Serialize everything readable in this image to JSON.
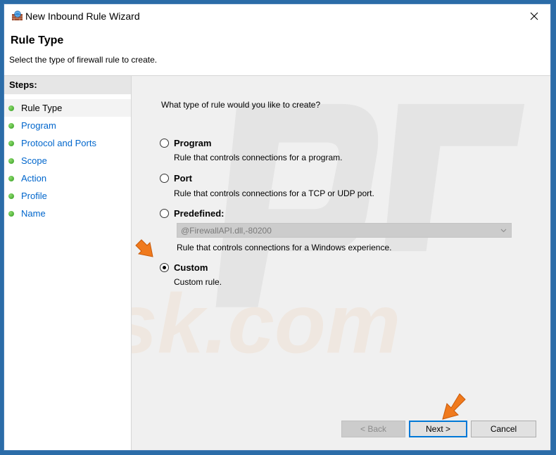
{
  "window": {
    "title": "New Inbound Rule Wizard"
  },
  "header": {
    "title": "Rule Type",
    "subtitle": "Select the type of firewall rule to create."
  },
  "steps": {
    "heading": "Steps:",
    "items": [
      {
        "label": "Rule Type",
        "active": true
      },
      {
        "label": "Program",
        "active": false
      },
      {
        "label": "Protocol and Ports",
        "active": false
      },
      {
        "label": "Scope",
        "active": false
      },
      {
        "label": "Action",
        "active": false
      },
      {
        "label": "Profile",
        "active": false
      },
      {
        "label": "Name",
        "active": false
      }
    ]
  },
  "main": {
    "question": "What type of rule would you like to create?",
    "options": [
      {
        "label": "Program",
        "description": "Rule that controls connections for a program.",
        "checked": false
      },
      {
        "label": "Port",
        "description": "Rule that controls connections for a TCP or UDP port.",
        "checked": false
      },
      {
        "label": "Predefined:",
        "description": "Rule that controls connections for a Windows experience.",
        "checked": false
      },
      {
        "label": "Custom",
        "description": "Custom rule.",
        "checked": true
      }
    ],
    "predefined_dropdown": {
      "value": "@FirewallAPI.dll,-80200",
      "enabled": false
    }
  },
  "buttons": {
    "back": "< Back",
    "next": "Next >",
    "cancel": "Cancel"
  },
  "watermark": {
    "text": "risk.com"
  },
  "colors": {
    "accent_arrow": "#f07a1d",
    "link_blue": "#0066cc",
    "step_dot_green": "#2f9b1d"
  },
  "icons": {
    "app": "firewall-wall-globe-icon",
    "close": "close-icon",
    "chevron": "chevron-down-icon",
    "annotation": "arrow-pointer-icon"
  }
}
